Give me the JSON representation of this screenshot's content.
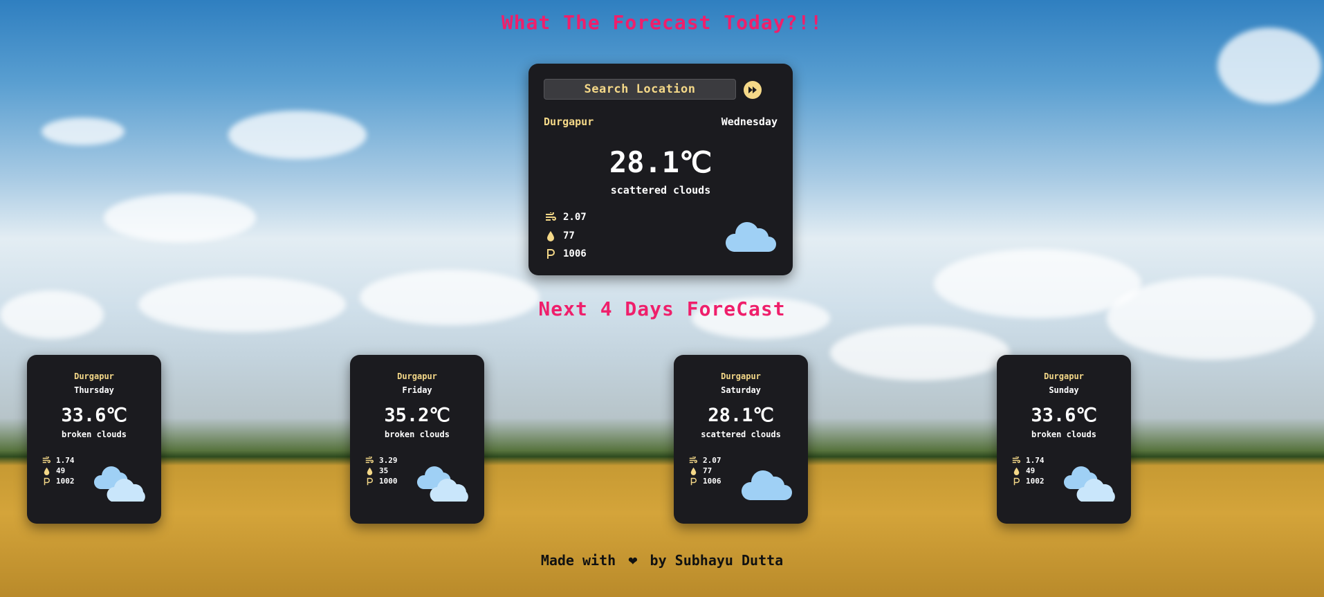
{
  "page_title": "What The Forecast Today?!!",
  "search": {
    "placeholder": "Search Location",
    "button_icon": "fast-forward-icon"
  },
  "current": {
    "city": "Durgapur",
    "day": "Wednesday",
    "temperature": "28.1℃",
    "description": "scattered clouds",
    "wind": "2.07",
    "humidity": "77",
    "pressure": "1006",
    "icon": "cloud-icon"
  },
  "forecast_heading": "Next 4 Days ForeCast",
  "forecast": [
    {
      "city": "Durgapur",
      "day": "Thursday",
      "temperature": "33.6℃",
      "description": "broken clouds",
      "wind": "1.74",
      "humidity": "49",
      "pressure": "1002",
      "icon": "broken-clouds-icon"
    },
    {
      "city": "Durgapur",
      "day": "Friday",
      "temperature": "35.2℃",
      "description": "broken clouds",
      "wind": "3.29",
      "humidity": "35",
      "pressure": "1000",
      "icon": "broken-clouds-icon"
    },
    {
      "city": "Durgapur",
      "day": "Saturday",
      "temperature": "28.1℃",
      "description": "scattered clouds",
      "wind": "2.07",
      "humidity": "77",
      "pressure": "1006",
      "icon": "cloud-icon"
    },
    {
      "city": "Durgapur",
      "day": "Sunday",
      "temperature": "33.6℃",
      "description": "broken clouds",
      "wind": "1.74",
      "humidity": "49",
      "pressure": "1002",
      "icon": "broken-clouds-icon"
    }
  ],
  "footer": {
    "prefix": "Made with",
    "suffix": "by Subhayu Dutta",
    "heart_icon": "heart-icon"
  },
  "colors": {
    "accent": "#ef1f6b",
    "label_yellow": "#f4d888",
    "card_bg": "#1b1b1f",
    "cloud": "#9fd0f5"
  }
}
